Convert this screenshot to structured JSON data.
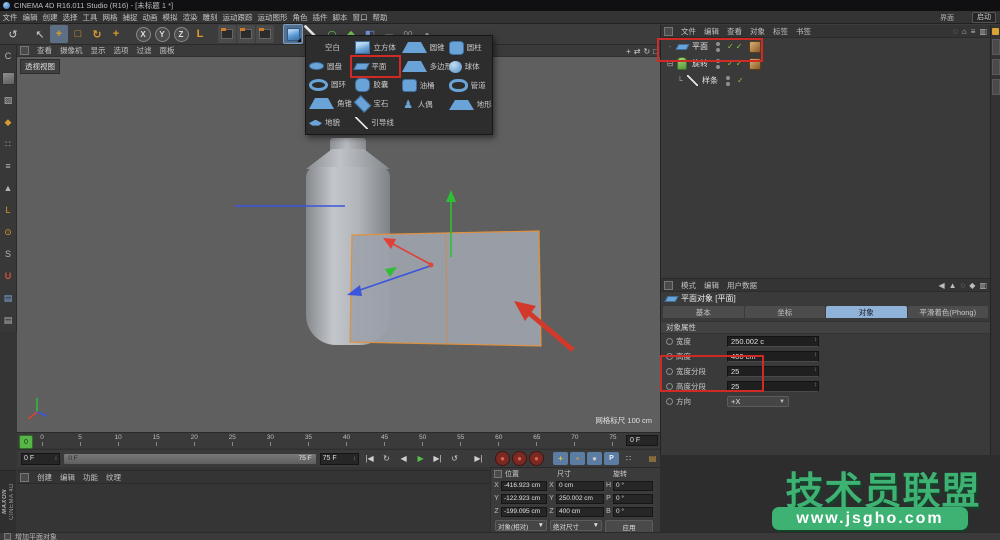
{
  "window": {
    "title": "CINEMA 4D R16.011 Studio (R16) - [未标题 1 *]"
  },
  "menu_bar": {
    "items": [
      "文件",
      "编辑",
      "创建",
      "选择",
      "工具",
      "网格",
      "捕捉",
      "动画",
      "模拟",
      "渲染",
      "雕刻",
      "运动跟踪",
      "运动图形",
      "角色",
      "插件",
      "脚本",
      "窗口",
      "帮助"
    ],
    "layout_label": "界面",
    "layout_value": "启动"
  },
  "viewport": {
    "menu": [
      "查看",
      "摄像机",
      "显示",
      "选项",
      "过滤",
      "面板"
    ],
    "corner_icons": [
      "+",
      "⇄",
      "↻",
      "□"
    ],
    "view_label": "透视视图",
    "grid_label": "网格标尺 100 cm"
  },
  "primitive_menu": {
    "columns": [
      [
        {
          "icon": "null",
          "label": "空白"
        },
        {
          "icon": "disc",
          "label": "圆盘"
        },
        {
          "icon": "ring",
          "label": "圆环"
        },
        {
          "icon": "pyramid",
          "label": "角锥"
        },
        {
          "icon": "relief",
          "label": "地貌"
        }
      ],
      [
        {
          "icon": "cube",
          "label": "立方体"
        },
        {
          "icon": "plane",
          "label": "平面",
          "highlighted": true
        },
        {
          "icon": "capsule",
          "label": "胶囊"
        },
        {
          "icon": "gem",
          "label": "宝石"
        },
        {
          "icon": "guide",
          "label": "引导线"
        }
      ],
      [
        {
          "icon": "cone",
          "label": "圆锥"
        },
        {
          "icon": "polygon",
          "label": "多边形"
        },
        {
          "icon": "oiltank",
          "label": "油桶"
        },
        {
          "icon": "figure",
          "label": "人偶"
        }
      ],
      [
        {
          "icon": "cylinder",
          "label": "圆柱"
        },
        {
          "icon": "sphere",
          "label": "球体"
        },
        {
          "icon": "tube",
          "label": "管道"
        },
        {
          "icon": "landscape",
          "label": "地形"
        }
      ]
    ]
  },
  "object_manager": {
    "menu": [
      "文件",
      "编辑",
      "查看",
      "对象",
      "标签",
      "书签"
    ],
    "objects": [
      {
        "name": "平面",
        "icon": "plane"
      },
      {
        "name": "旋转",
        "icon": "lathe"
      },
      {
        "name": "样条",
        "icon": "spline"
      }
    ]
  },
  "attribute_manager": {
    "menu": [
      "模式",
      "编辑",
      "用户数据"
    ],
    "title": "平面对象 [平面]",
    "tabs": [
      {
        "label": "基本"
      },
      {
        "label": "坐标"
      },
      {
        "label": "对象",
        "cls": "active"
      },
      {
        "label": "平滑着色(Phong)"
      }
    ],
    "section": "对象属性",
    "fields": [
      {
        "label": "宽度",
        "value": "250.002 c"
      },
      {
        "label": "高度",
        "value": "400 cm"
      },
      {
        "label": "宽度分段",
        "value": "25"
      },
      {
        "label": "高度分段",
        "value": "25"
      },
      {
        "label": "方向",
        "value": "+X"
      }
    ]
  },
  "timeline": {
    "playhead": "0",
    "ticks": [
      "0",
      "5",
      "10",
      "15",
      "20",
      "25",
      "30",
      "35",
      "40",
      "45",
      "50",
      "55",
      "60",
      "65",
      "70",
      "75"
    ],
    "right_field": "0 F"
  },
  "transport": {
    "start_value": "0 F",
    "end_value": "75 F",
    "scrub_start": "0 F",
    "scrub_end": "75 F",
    "buttons": [
      {
        "g": "|◀",
        "cls": "t-plain"
      },
      {
        "g": "↻",
        "cls": "t-plain"
      },
      {
        "g": "◀",
        "cls": "t-plain"
      },
      {
        "g": "▶",
        "cls": "t-play"
      },
      {
        "g": "▶|",
        "cls": "t-plain"
      },
      {
        "g": "↺",
        "cls": "t-plain"
      },
      {
        "g": "▶|",
        "cls": "t-plain t-gap"
      },
      {
        "g": "●",
        "cls": "t-rec t-gap"
      },
      {
        "g": "●",
        "cls": "t-rec"
      },
      {
        "g": "●",
        "cls": "t-rec"
      },
      {
        "g": "+",
        "cls": "t-key t-gap"
      },
      {
        "g": "▪",
        "cls": "t-key2"
      },
      {
        "g": "●",
        "cls": "t-key3"
      },
      {
        "g": "P",
        "cls": "t-key4"
      },
      {
        "g": "∷",
        "cls": "t-dots"
      },
      {
        "g": "▤",
        "cls": "t-film t-gap"
      }
    ]
  },
  "coordinates": {
    "headers": [
      "位置",
      "尺寸",
      "旋转"
    ],
    "rows": [
      {
        "pa": "X",
        "pv": "-416.923 cm",
        "sa": "X",
        "sv": "0 cm",
        "ra": "H",
        "rv": "0 °"
      },
      {
        "pa": "Y",
        "pv": "-122.923 cm",
        "sa": "Y",
        "sv": "250.002 cm",
        "ra": "P",
        "rv": "0 °"
      },
      {
        "pa": "Z",
        "pv": "-199.095 cm",
        "sa": "Z",
        "sv": "400 cm",
        "ra": "B",
        "rv": "0 °"
      }
    ],
    "mode_object": "对象(相对)",
    "mode_size": "绝对尺寸",
    "apply_label": "应用"
  },
  "material_manager": {
    "menu": [
      "创建",
      "编辑",
      "功能",
      "纹理"
    ]
  },
  "status_bar": {
    "text": "增加平面对象"
  },
  "brand": {
    "line1": "MAXON",
    "line2": "CINEMA 4D"
  },
  "watermark": {
    "title": "技术员联盟",
    "url": "www.jsgho.com"
  },
  "colors": {
    "annotation_red": "#cf2a26",
    "watermark_green": "#3db273",
    "selection_orange": "#e0913f"
  }
}
